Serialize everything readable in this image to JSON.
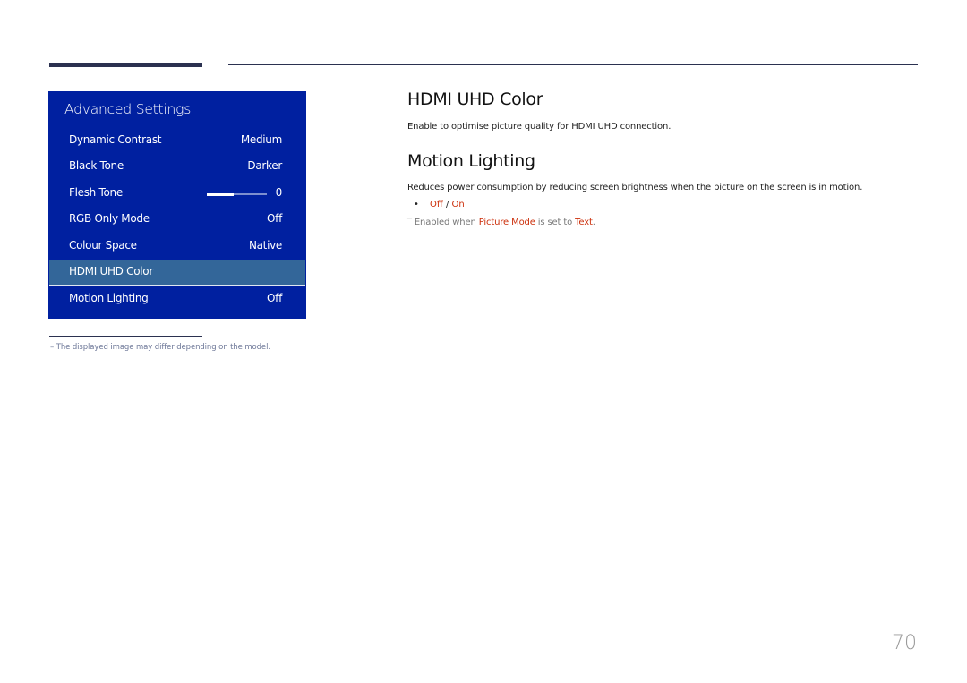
{
  "panel": {
    "title": "Advanced Settings",
    "items": [
      {
        "label": "Dynamic Contrast",
        "value": "Medium"
      },
      {
        "label": "Black Tone",
        "value": "Darker"
      },
      {
        "label": "Flesh Tone",
        "value": "0",
        "slider_fraction": 0.45
      },
      {
        "label": "RGB Only Mode",
        "value": "Off"
      },
      {
        "label": "Colour Space",
        "value": "Native"
      },
      {
        "label": "HDMI UHD Color",
        "value": "",
        "selected": true
      },
      {
        "label": "Motion Lighting",
        "value": "Off"
      }
    ],
    "colors": {
      "background": "#0020a0",
      "selected": "#336699"
    }
  },
  "footnote": "–  The displayed image may differ depending on the model.",
  "sections": {
    "hdmi": {
      "title": "HDMI UHD Color",
      "desc": "Enable to optimise picture quality for HDMI UHD connection."
    },
    "motion": {
      "title": "Motion Lighting",
      "desc": "Reduces power consumption by reducing screen brightness when the picture on the screen is in motion.",
      "bullet": "•",
      "opt_off": "Off",
      "opt_sep": " / ",
      "opt_on": "On",
      "note_prefix": "‾ Enabled when ",
      "note_hl1": "Picture Mode",
      "note_mid": " is set to ",
      "note_hl2": "Text",
      "note_suffix": "."
    }
  },
  "page_number": "70",
  "accent_color": "#cc2e0a"
}
